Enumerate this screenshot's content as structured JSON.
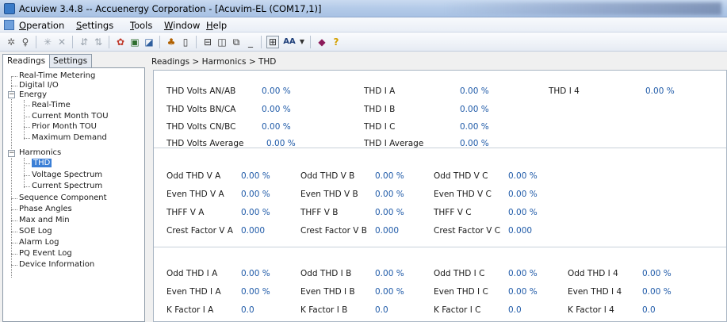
{
  "window": {
    "title": "Acuview 3.4.8 -- Accuenergy Corporation - [Acuvim-EL (COM17,1)]"
  },
  "menu": [
    "Operation",
    "Settings",
    "Tools",
    "Window",
    "Help"
  ],
  "toolbar": {
    "icons": [
      "gear-icon",
      "pin-icon",
      "star-disabled-icon",
      "cross-disabled-icon",
      "arrows-disabled-icon",
      "arrows2-disabled-icon",
      "flower-icon",
      "monitor-icon",
      "chart-icon",
      "network-icon",
      "device-icon",
      "horizontal-layout-icon",
      "vertical-layout-icon",
      "cascade-icon",
      "minimize-all-icon",
      "view-icon",
      "font-size-icon",
      "dropdown-icon",
      "book-icon",
      "help-icon"
    ],
    "font_size_label": "AA"
  },
  "tabs": [
    "Readings",
    "Settings"
  ],
  "tree": {
    "real_time_metering": "Real-Time Metering",
    "digital_io": "Digital I/O",
    "energy": "Energy",
    "energy_real_time": "Real-Time",
    "current_month_tou": "Current Month TOU",
    "prior_month_tou": "Prior Month TOU",
    "maximum_demand": "Maximum Demand",
    "harmonics": "Harmonics",
    "thd": "THD",
    "voltage_spectrum": "Voltage Spectrum",
    "current_spectrum": "Current Spectrum",
    "sequence_component": "Sequence Component",
    "phase_angles": "Phase Angles",
    "max_and_min": "Max and Min",
    "soe_log": "SOE Log",
    "alarm_log": "Alarm Log",
    "pq_event_log": "PQ Event Log",
    "device_information": "Device Information"
  },
  "breadcrumb": "Readings > Harmonics > THD",
  "section1": {
    "labels": [
      "THD Volts AN/AB",
      "THD Volts BN/CA",
      "THD Volts CN/BC",
      "THD Volts Average"
    ],
    "values": [
      "0.00 %",
      "0.00 %",
      "0.00 %",
      "0.00 %"
    ],
    "labels_i": [
      "THD I A",
      "THD I B",
      "THD I C",
      "THD I Average"
    ],
    "values_i": [
      "0.00 %",
      "0.00 %",
      "0.00 %",
      "0.00 %"
    ],
    "label_i4": "THD I 4",
    "value_i4": "0.00 %"
  },
  "section2": {
    "col_a": {
      "labels": [
        "Odd THD V A",
        "Even THD V A",
        "THFF V A",
        "Crest Factor V A"
      ],
      "values": [
        "0.00 %",
        "0.00 %",
        "0.00 %",
        "0.000"
      ]
    },
    "col_b": {
      "labels": [
        "Odd THD V B",
        "Even THD V B",
        "THFF V B",
        "Crest Factor V B"
      ],
      "values": [
        "0.00 %",
        "0.00 %",
        "0.00 %",
        "0.000"
      ]
    },
    "col_c": {
      "labels": [
        "Odd THD V C",
        "Even THD V C",
        "THFF V C",
        "Crest Factor V C"
      ],
      "values": [
        "0.00 %",
        "0.00 %",
        "0.00 %",
        "0.000"
      ]
    }
  },
  "section3": {
    "col_a": {
      "labels": [
        "Odd THD I A",
        "Even THD I A",
        "K Factor I A"
      ],
      "values": [
        "0.00 %",
        "0.00 %",
        "0.0"
      ]
    },
    "col_b": {
      "labels": [
        "Odd THD I B",
        "Even THD I B",
        "K Factor I B"
      ],
      "values": [
        "0.00 %",
        "0.00 %",
        "0.0"
      ]
    },
    "col_c": {
      "labels": [
        "Odd THD I C",
        "Even THD I C",
        "K Factor I C"
      ],
      "values": [
        "0.00 %",
        "0.00 %",
        "0.0"
      ]
    },
    "col_4": {
      "labels": [
        "Odd THD I 4",
        "Even THD I 4",
        "K Factor I 4"
      ],
      "values": [
        "0.00 %",
        "0.00 %",
        "0.0"
      ]
    }
  }
}
